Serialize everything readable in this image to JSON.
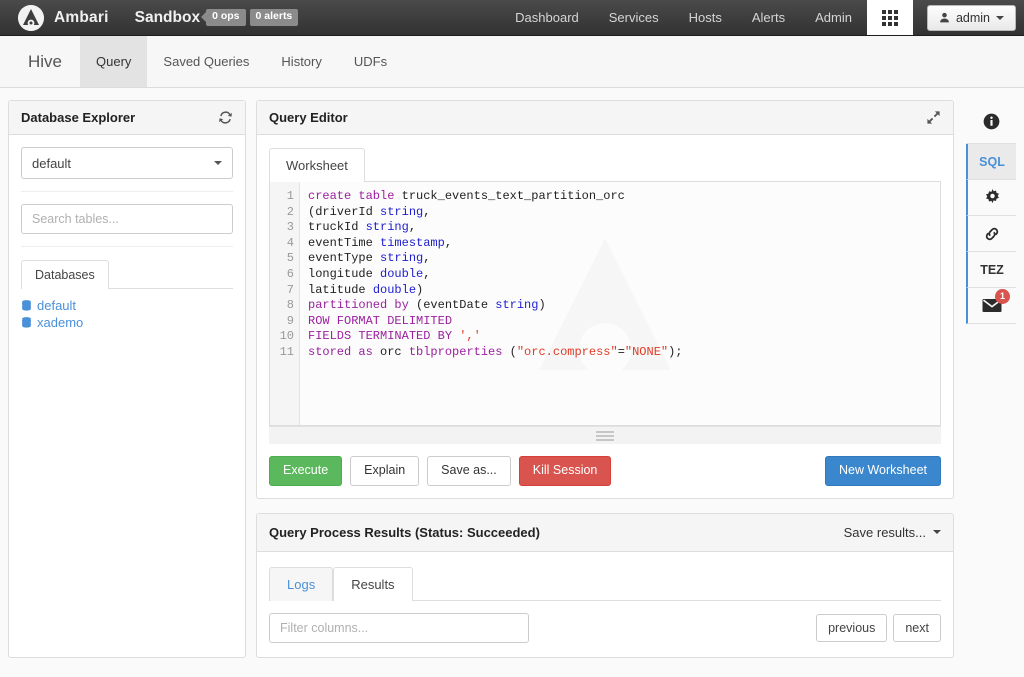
{
  "navbar": {
    "brand": "Ambari",
    "cluster": "Sandbox",
    "ops_badge": "0 ops",
    "alerts_badge": "0 alerts",
    "links": [
      "Dashboard",
      "Services",
      "Hosts",
      "Alerts",
      "Admin"
    ],
    "grid_icon": "grid-apps-icon",
    "user_label": "admin",
    "user_icon": "user-icon"
  },
  "viewbar": {
    "title": "Hive",
    "tabs": [
      {
        "label": "Query",
        "active": true
      },
      {
        "label": "Saved Queries",
        "active": false
      },
      {
        "label": "History",
        "active": false
      },
      {
        "label": "UDFs",
        "active": false
      }
    ]
  },
  "db_explorer": {
    "title": "Database Explorer",
    "refresh_icon": "refresh-icon",
    "database_select": {
      "value": "default",
      "icon": "chevron-down-icon"
    },
    "search": {
      "placeholder": "Search tables...",
      "value": "",
      "icon": "search-input"
    },
    "tab_label": "Databases",
    "databases": [
      {
        "name": "default",
        "icon": "database-icon"
      },
      {
        "name": "xademo",
        "icon": "database-icon"
      }
    ]
  },
  "query_editor": {
    "title": "Query Editor",
    "expand_icon": "expand-arrows-icon",
    "worksheet_tab": "Worksheet",
    "resize_handle": "resize-grip-handle",
    "watermark": "ambari-logo-watermark",
    "line_numbers": [
      "1",
      "2",
      "3",
      "4",
      "5",
      "6",
      "7",
      "8",
      "9",
      "10",
      "11"
    ],
    "code_lines": [
      {
        "n": 1,
        "tokens": [
          {
            "c": "k",
            "t": "create table "
          },
          {
            "c": "p",
            "t": "truck_events_text_partition_orc"
          }
        ]
      },
      {
        "n": 2,
        "tokens": [
          {
            "c": "p",
            "t": "(driverId "
          },
          {
            "c": "t",
            "t": "string"
          },
          {
            "c": "p",
            "t": ","
          }
        ]
      },
      {
        "n": 3,
        "tokens": [
          {
            "c": "p",
            "t": "truckId "
          },
          {
            "c": "t",
            "t": "string"
          },
          {
            "c": "p",
            "t": ","
          }
        ]
      },
      {
        "n": 4,
        "tokens": [
          {
            "c": "p",
            "t": "eventTime "
          },
          {
            "c": "t",
            "t": "timestamp"
          },
          {
            "c": "p",
            "t": ","
          }
        ]
      },
      {
        "n": 5,
        "tokens": [
          {
            "c": "p",
            "t": "eventType "
          },
          {
            "c": "t",
            "t": "string"
          },
          {
            "c": "p",
            "t": ","
          }
        ]
      },
      {
        "n": 6,
        "tokens": [
          {
            "c": "p",
            "t": "longitude "
          },
          {
            "c": "t",
            "t": "double"
          },
          {
            "c": "p",
            "t": ","
          }
        ]
      },
      {
        "n": 7,
        "tokens": [
          {
            "c": "p",
            "t": "latitude "
          },
          {
            "c": "t",
            "t": "double"
          },
          {
            "c": "p",
            "t": ")"
          }
        ]
      },
      {
        "n": 8,
        "tokens": [
          {
            "c": "k",
            "t": "partitioned by "
          },
          {
            "c": "p",
            "t": "(eventDate "
          },
          {
            "c": "t",
            "t": "string"
          },
          {
            "c": "p",
            "t": ")"
          }
        ]
      },
      {
        "n": 9,
        "tokens": [
          {
            "c": "k",
            "t": "ROW FORMAT DELIMITED"
          }
        ]
      },
      {
        "n": 10,
        "tokens": [
          {
            "c": "k",
            "t": "FIELDS TERMINATED BY "
          },
          {
            "c": "s",
            "t": "','"
          }
        ]
      },
      {
        "n": 11,
        "tokens": [
          {
            "c": "k",
            "t": "stored as "
          },
          {
            "c": "p",
            "t": "orc "
          },
          {
            "c": "k",
            "t": "tblproperties "
          },
          {
            "c": "p",
            "t": "("
          },
          {
            "c": "s",
            "t": "\"orc.compress\""
          },
          {
            "c": "p",
            "t": "="
          },
          {
            "c": "s",
            "t": "\"NONE\""
          },
          {
            "c": "p",
            "t": ");"
          }
        ]
      }
    ],
    "buttons": {
      "execute": "Execute",
      "explain": "Explain",
      "save_as": "Save as...",
      "kill_session": "Kill Session",
      "new_worksheet": "New Worksheet"
    }
  },
  "results": {
    "title": "Query Process Results (Status: Succeeded)",
    "save_results_label": "Save results...",
    "save_results_icon": "chevron-down-icon",
    "tabs": [
      {
        "label": "Logs",
        "active": false
      },
      {
        "label": "Results",
        "active": true
      }
    ],
    "filter": {
      "placeholder": "Filter columns...",
      "value": ""
    },
    "pager": {
      "previous": "previous",
      "next": "next"
    }
  },
  "rail": {
    "info_icon": "info-circle-icon",
    "items": [
      {
        "label": "SQL",
        "icon": "sql-text-icon",
        "selected": true,
        "badge": ""
      },
      {
        "label": "",
        "icon": "gear-icon",
        "selected": false,
        "badge": ""
      },
      {
        "label": "",
        "icon": "link-chain-icon",
        "selected": false,
        "badge": ""
      },
      {
        "label": "TEZ",
        "icon": "tez-text-icon",
        "selected": false,
        "badge": ""
      },
      {
        "label": "",
        "icon": "envelope-icon",
        "selected": false,
        "badge": "1"
      }
    ]
  },
  "colors": {
    "navbar_dark": "#3a3a3a",
    "accent_blue": "#4a90d9",
    "success_green": "#5cb85c",
    "danger_red": "#d9534f",
    "primary_blue": "#3a87cd",
    "keyword_purple": "#9b1fa0",
    "type_blue": "#2020d0",
    "string_red": "#e03b26"
  }
}
